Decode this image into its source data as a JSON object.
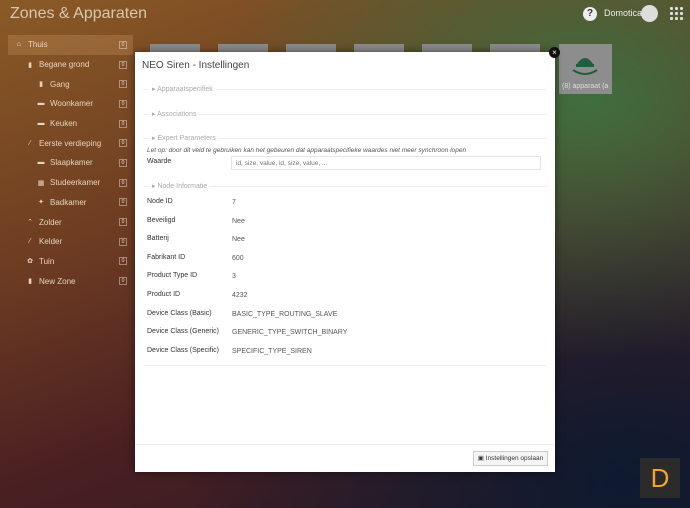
{
  "header": {
    "title": "Zones & Apparaten",
    "help": "?",
    "user": "Domotica"
  },
  "sidebar": {
    "items": [
      {
        "label": "Thuis",
        "icon": "⌂",
        "count": "0",
        "level": 0
      },
      {
        "label": "Begane grond",
        "icon": "▮",
        "count": "0",
        "level": 1
      },
      {
        "label": "Gang",
        "icon": "▮",
        "count": "0",
        "level": 2
      },
      {
        "label": "Woonkamer",
        "icon": "▬",
        "count": "0",
        "level": 2
      },
      {
        "label": "Keuken",
        "icon": "▬",
        "count": "0",
        "level": 2
      },
      {
        "label": "Eerste verdieping",
        "icon": "⁄",
        "count": "0",
        "level": 1
      },
      {
        "label": "Slaapkamer",
        "icon": "▬",
        "count": "0",
        "level": 2
      },
      {
        "label": "Studeerkamer",
        "icon": "▦",
        "count": "0",
        "level": 2
      },
      {
        "label": "Badkamer",
        "icon": "✦",
        "count": "0",
        "level": 2
      },
      {
        "label": "Zolder",
        "icon": "⌃",
        "count": "0",
        "level": 1
      },
      {
        "label": "Kelder",
        "icon": "⁄",
        "count": "0",
        "level": 1
      },
      {
        "label": "Tuin",
        "icon": "✿",
        "count": "0",
        "level": 1
      },
      {
        "label": "New Zone",
        "icon": "▮",
        "count": "0",
        "level": 1
      }
    ]
  },
  "device_tile": {
    "label": "(8) apparaat (a"
  },
  "modal": {
    "title": "NEO Siren - Instellingen",
    "close": "×",
    "sections": [
      "Apparaatspecifiek",
      "Associations",
      "Expert Parameters",
      "Node Informatie"
    ],
    "note": "Let op: door dit veld te gebruiken kan het gebeuren dat apparaatspecifieke waardes niet meer synchroon lopen",
    "waarde_label": "Waarde",
    "waarde_placeholder": "id, size, value, id, size, value, ...",
    "info": [
      {
        "label": "Node ID",
        "value": "7"
      },
      {
        "label": "Beveiligd",
        "value": "Nee"
      },
      {
        "label": "Batterij",
        "value": "Nee"
      },
      {
        "label": "Fabrikant ID",
        "value": "600"
      },
      {
        "label": "Product Type ID",
        "value": "3"
      },
      {
        "label": "Product ID",
        "value": "4232"
      },
      {
        "label": "Device Class (Basic)",
        "value": "BASIC_TYPE_ROUTING_SLAVE"
      },
      {
        "label": "Device Class (Generic)",
        "value": "GENERIC_TYPE_SWITCH_BINARY"
      },
      {
        "label": "Device Class (Specific)",
        "value": "SPECIFIC_TYPE_SIREN"
      }
    ],
    "save": "Instellingen opslaan"
  },
  "logo": "D"
}
